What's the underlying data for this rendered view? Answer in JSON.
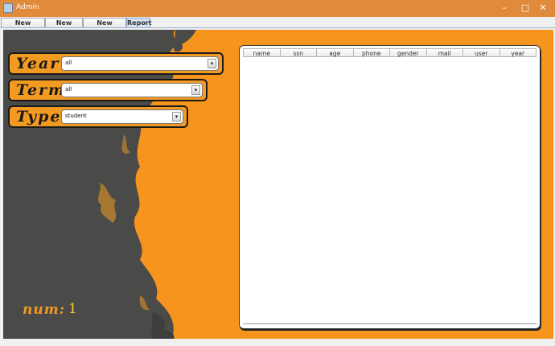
{
  "window": {
    "title": "Admin",
    "min_glyph": "–",
    "max_glyph": "□",
    "close_glyph": "✕"
  },
  "tabs": [
    {
      "label": "New Student"
    },
    {
      "label": "New course"
    },
    {
      "label": "New Schedule"
    },
    {
      "label": "Report",
      "selected": true
    }
  ],
  "filters": {
    "year": {
      "label": "Year",
      "value": "all"
    },
    "term": {
      "label": "Term",
      "value": "all"
    },
    "type": {
      "label": "Type",
      "value": "student"
    },
    "arrow_glyph": "▾"
  },
  "counter": {
    "label": "num:",
    "value": "1"
  },
  "table": {
    "columns": [
      "name",
      "ssn",
      "age",
      "phone",
      "gender",
      "mail",
      "user",
      "year"
    ],
    "rows": []
  },
  "colors": {
    "accent_orange": "#f7941d",
    "titlebar": "#e08a3c",
    "dark_texture": "#4a4a48",
    "num_value": "#f7c93c"
  },
  "icons": {
    "app": "java-cup-icon",
    "dropdown": "chevron-down-icon"
  }
}
